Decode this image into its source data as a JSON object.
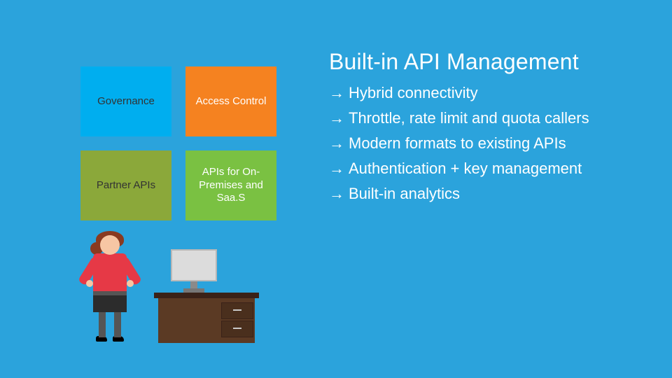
{
  "tiles": {
    "governance": "Governance",
    "access": "Access Control",
    "partner": "Partner APIs",
    "saas": "APIs for On-Premises and Saa.S"
  },
  "title": "Built-in API Management",
  "bullets": [
    "Hybrid connectivity",
    "Throttle, rate limit and quota callers",
    "Modern formats to existing APIs",
    "Authentication + key management",
    "Built-in analytics"
  ],
  "arrow_glyph": "→"
}
